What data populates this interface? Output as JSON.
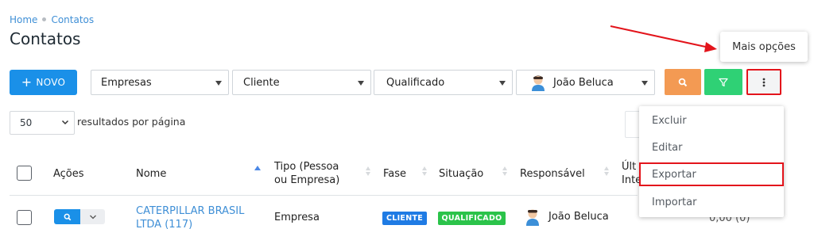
{
  "breadcrumb": {
    "home": "Home",
    "current": "Contatos"
  },
  "page_title": "Contatos",
  "toolbar": {
    "new_label": "+ NOVO",
    "new_plus": "+",
    "new_text": "NOVO",
    "filters": [
      {
        "name": "filter-company-type",
        "value": "Empresas"
      },
      {
        "name": "filter-client",
        "value": "Cliente"
      },
      {
        "name": "filter-status",
        "value": "Qualificado"
      },
      {
        "name": "filter-responsible",
        "value": "João Beluca"
      }
    ],
    "search_icon": "search-icon",
    "filter_icon": "filter-icon",
    "more_icon": "more-vertical-icon"
  },
  "tooltip": "Mais opções",
  "pagination": {
    "per_page": "50",
    "per_page_text": "resultados por página"
  },
  "table": {
    "headers": {
      "acoes": "Ações",
      "nome": "Nome",
      "tipo_l1": "Tipo (Pessoa",
      "tipo_l2": "ou Empresa)",
      "fase": "Fase",
      "situacao": "Situação",
      "responsavel": "Responsável",
      "ultima_l1": "Últ",
      "ultima_l2": "Inte"
    },
    "rows": [
      {
        "name_l1": "CATERPILLAR BRASIL",
        "name_l2": "LTDA (117)",
        "tipo": "Empresa",
        "fase": "CLIENTE",
        "situacao": "QUALIFICADO",
        "responsavel": "João Beluca",
        "interacoes": "0,00 (0)"
      }
    ]
  },
  "dropdown": {
    "items": [
      "Excluir",
      "Editar",
      "Exportar",
      "Importar"
    ]
  },
  "colors": {
    "primary": "#1a90e8",
    "search_btn": "#f39a53",
    "filter_btn": "#2fd175",
    "annotation_red": "#e3141b",
    "badge_client": "#1f7be4",
    "badge_qualified": "#2bc34a"
  }
}
